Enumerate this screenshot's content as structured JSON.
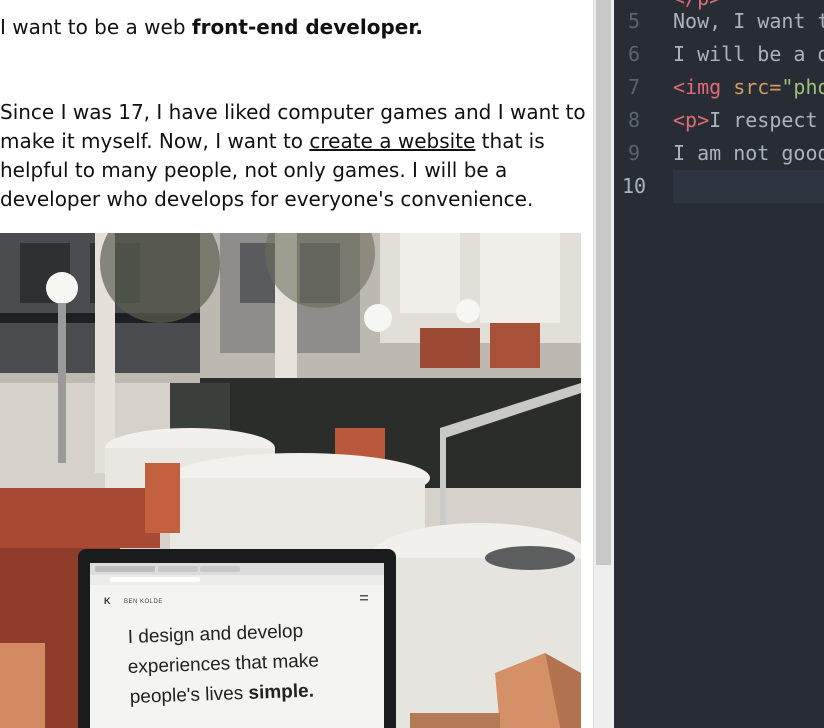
{
  "preview": {
    "intro_text": "I want to be a web ",
    "intro_bold": "front-end developer.",
    "para_before_link": "Since I was 17, I have liked computer games and I want to make it myself. Now, I want to ",
    "para_link": "create a website",
    "para_after_link": " that is helpful to many people, not only games. I will be a developer who develops for everyone's convenience.",
    "photo": {
      "brand": "BEN KOLDE",
      "headline_line1": "I design and develop",
      "headline_line2": "experiences that make",
      "headline_line3_regular": "people's lives ",
      "headline_line3_bold": "simple."
    }
  },
  "editor": {
    "lines": [
      {
        "num": "5",
        "text": "Now, I want t"
      },
      {
        "num": "6",
        "text": "I will be a d"
      },
      {
        "num": "7",
        "tag_open": "<img",
        "attr": " src=",
        "str": "\"pho"
      },
      {
        "num": "8",
        "tag_open": "<p>",
        "text": "I respect"
      },
      {
        "num": "9",
        "text": "I am not good"
      },
      {
        "num": "10",
        "text": ""
      }
    ]
  },
  "colors": {
    "editor_bg": "#282c34",
    "tag": "#e06c75",
    "attr": "#d19a66",
    "string": "#98c379"
  }
}
